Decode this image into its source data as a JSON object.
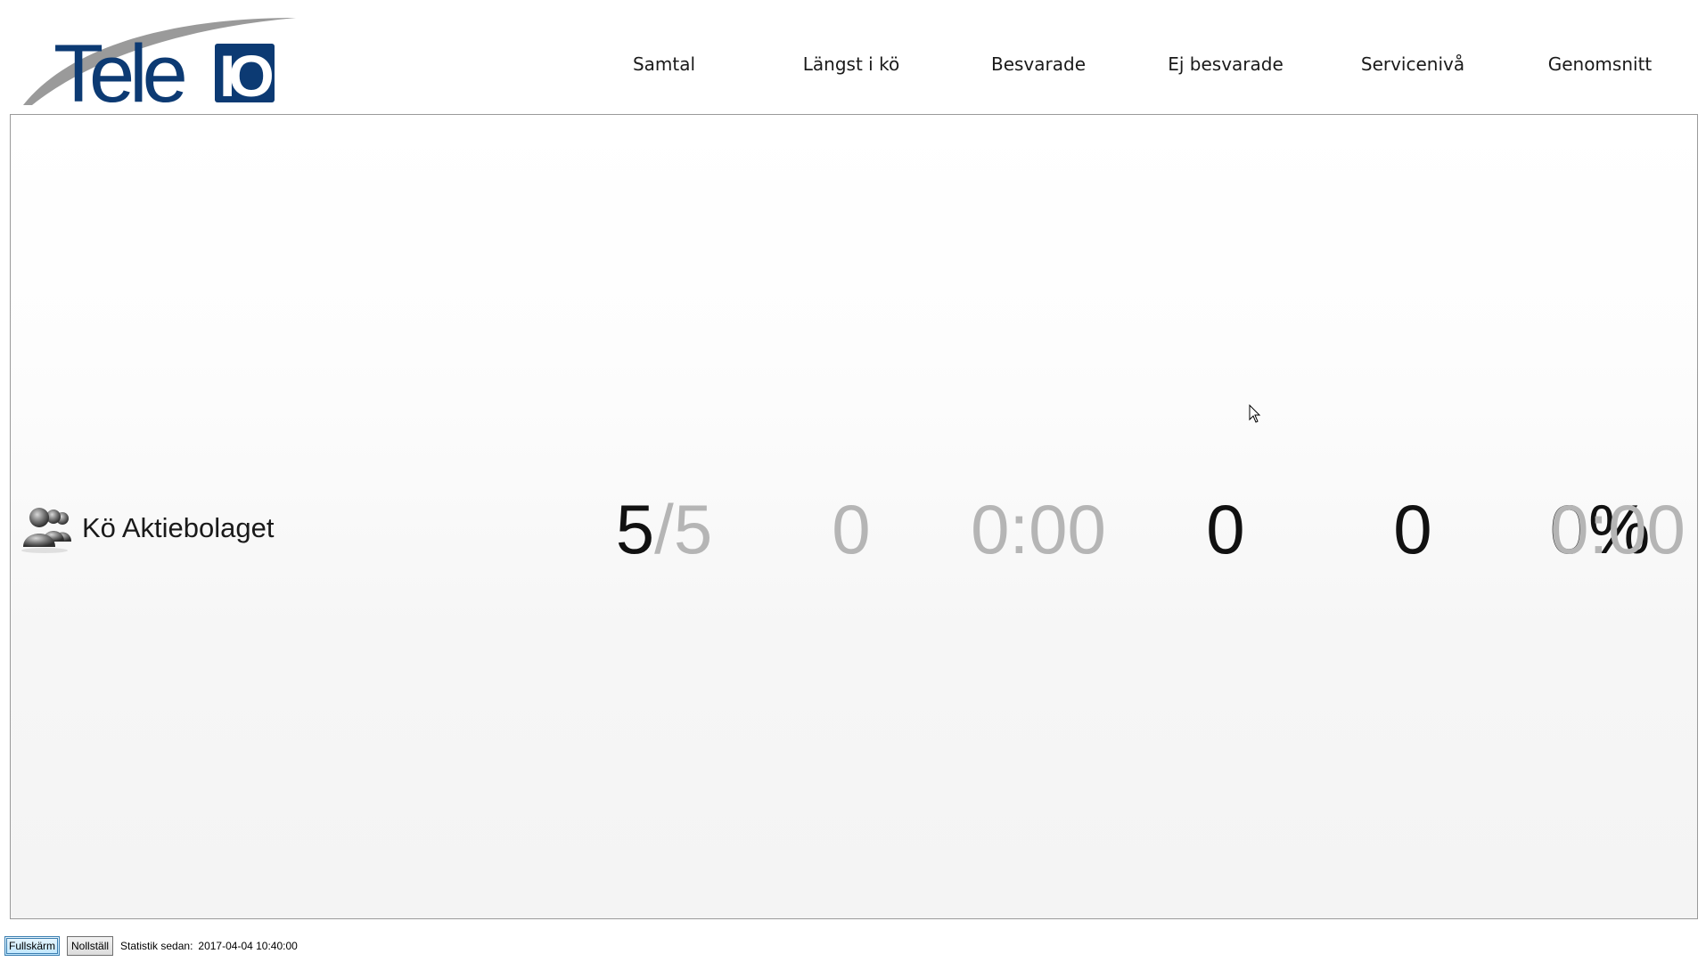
{
  "logo": {
    "text_main": "Tele",
    "text_box": "IO",
    "color": "#0c3a73"
  },
  "header": {
    "columns": [
      "Samtal",
      "Längst i kö",
      "Besvarade",
      "Ej besvarade",
      "Servicenivå",
      "Genomsnitt"
    ]
  },
  "queue": {
    "icon": "group-people-icon",
    "name": "Kö Aktiebolaget",
    "samtal_primary": "5",
    "samtal_secondary": "/5",
    "langst_i_ko": "0",
    "besvarade_time": "0:00",
    "besvarade": "0",
    "ej_besvarade": "0",
    "serviceniva": "0%",
    "genomsnitt": "0:00"
  },
  "footer": {
    "fullscreen_label": "Fullskärm",
    "reset_label": "Nollställ",
    "stats_since_label": "Statistik sedan:",
    "stats_since_value": "2017-04-04 10:40:00"
  },
  "colors": {
    "dark_value": "#111111",
    "muted_value": "#b5b5b5",
    "border": "#9a9a9a"
  }
}
